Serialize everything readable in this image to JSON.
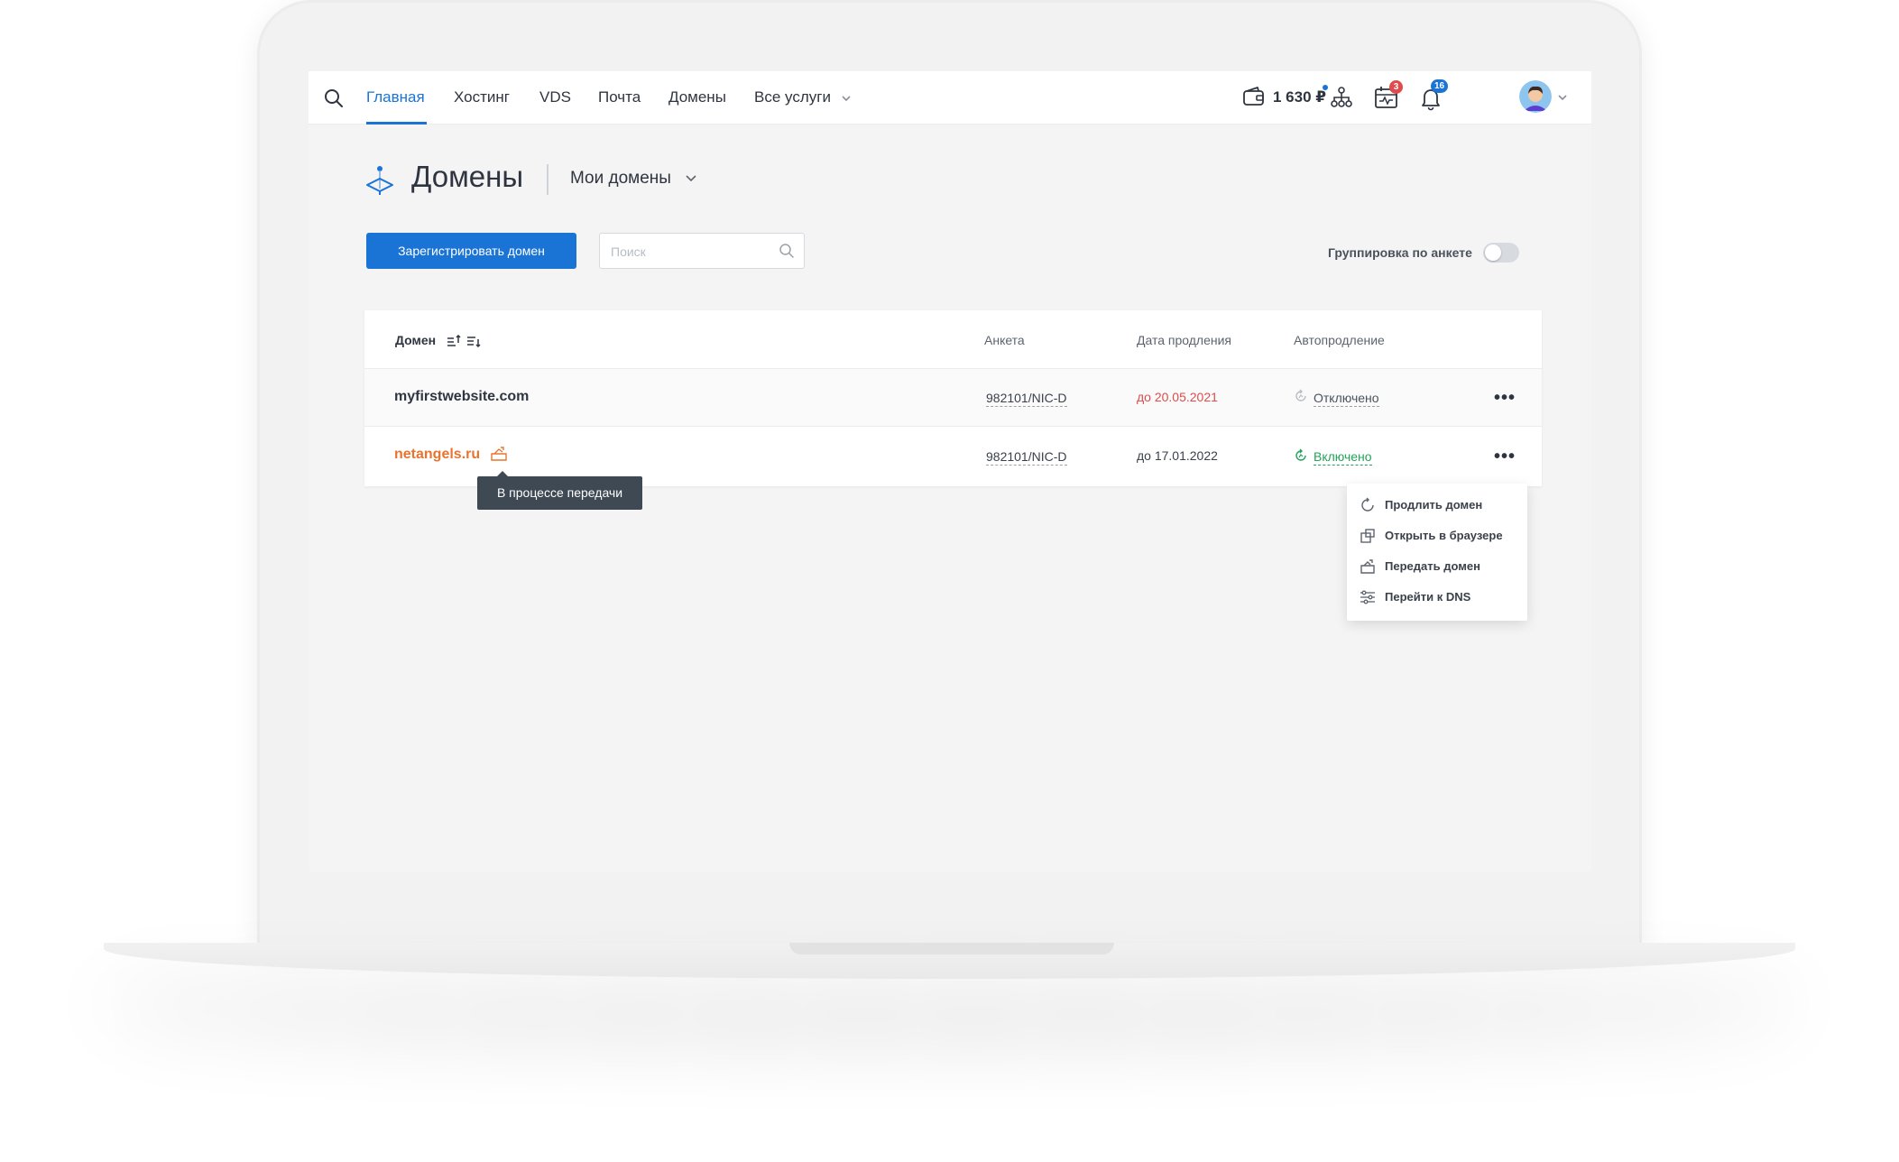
{
  "nav": {
    "items": [
      {
        "label": "Главная",
        "active": true
      },
      {
        "label": "Хостинг"
      },
      {
        "label": "VDS"
      },
      {
        "label": "Почта"
      },
      {
        "label": "Домены"
      },
      {
        "label": "Все услуги"
      }
    ],
    "balance": "1 630 ₽",
    "calendar_badge": "3",
    "notifications_badge": "16"
  },
  "page": {
    "title": "Домены",
    "filter_label": "Мои домены",
    "register_button": "Зарегистрировать домен",
    "search_placeholder": "Поиск",
    "grouping_label": "Группировка по анкете",
    "grouping_enabled": false
  },
  "table": {
    "headers": {
      "domain": "Домен",
      "profile": "Анкета",
      "renewal_date": "Дата продления",
      "autorenew": "Автопродление"
    },
    "rows": [
      {
        "domain": "myfirstwebsite.com",
        "profile": "982101/NIC-D",
        "renewal_date": "до 20.05.2021",
        "autorenew": "Отключено"
      },
      {
        "domain": "netangels.ru",
        "profile": "982101/NIC-D",
        "renewal_date": "до 17.01.2022",
        "autorenew": "Включено"
      }
    ]
  },
  "tooltip": "В процессе передачи",
  "context_menu": {
    "items": [
      {
        "label": "Продлить домен",
        "icon": "renew-icon"
      },
      {
        "label": "Открыть в браузере",
        "icon": "open-external-icon"
      },
      {
        "label": "Передать домен",
        "icon": "transfer-icon"
      },
      {
        "label": "Перейти к DNS",
        "icon": "dns-settings-icon"
      }
    ]
  },
  "colors": {
    "accent": "#1a74d6",
    "danger": "#e04b4b",
    "success": "#23a35a",
    "warning": "#e8742f",
    "tooltip_bg": "#3e4953"
  }
}
